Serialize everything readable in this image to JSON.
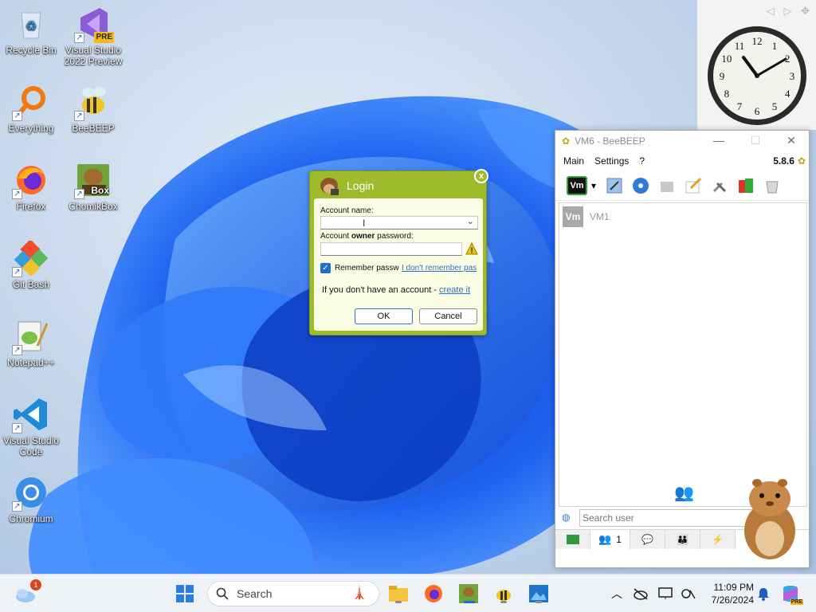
{
  "desktop": {
    "icons": [
      {
        "label": "Recycle Bin"
      },
      {
        "label": "Visual Studio 2022 Preview",
        "badge": "PRE"
      },
      {
        "label": "Everything"
      },
      {
        "label": "BeeBEEP"
      },
      {
        "label": "Firefox"
      },
      {
        "label": "ChomikBox",
        "badge": "Box"
      },
      {
        "label": "Git Bash"
      },
      {
        "label": "Notepad++"
      },
      {
        "label": "Visual Studio Code"
      },
      {
        "label": "Chromium"
      }
    ]
  },
  "clock": {
    "numbers": [
      "12",
      "1",
      "2",
      "3",
      "4",
      "5",
      "6",
      "7",
      "8",
      "9",
      "10",
      "11"
    ],
    "controls": [
      "◁",
      "▷",
      "✥"
    ]
  },
  "beebeep": {
    "title": "VM6 - BeeBEEP",
    "menu": [
      "Main",
      "Settings",
      "?"
    ],
    "version": "5.8.6",
    "status_badge": "Vm",
    "users": [
      {
        "avatar": "Vm",
        "name": "VM1"
      }
    ],
    "search_placeholder": "Search user",
    "tab_count": "1",
    "controls": {
      "minimize": "—",
      "maximize": "☐",
      "close": "✕"
    }
  },
  "login": {
    "title": "Login",
    "close": "x",
    "account_name_label": "Account name:",
    "password_label_prefix": "Account ",
    "password_label_bold": "owner",
    "password_label_suffix": " password:",
    "remember_label": "Remember passw",
    "forgot_link": "I don't remember pas",
    "no_account_text": "If you don't have an account - ",
    "create_link": "create it",
    "ok_label": "OK",
    "cancel_label": "Cancel",
    "warning_symbol": "!"
  },
  "taskbar": {
    "search_label": "Search",
    "notification_count": "1",
    "time": "11:09 PM",
    "date": "7/26/2024",
    "copilot_badge": "PRE"
  },
  "colors": {
    "login_green": "#9dbb2b",
    "login_body": "#fbfde4",
    "link_blue": "#2a70c8",
    "taskbar": "#eef2f7"
  }
}
